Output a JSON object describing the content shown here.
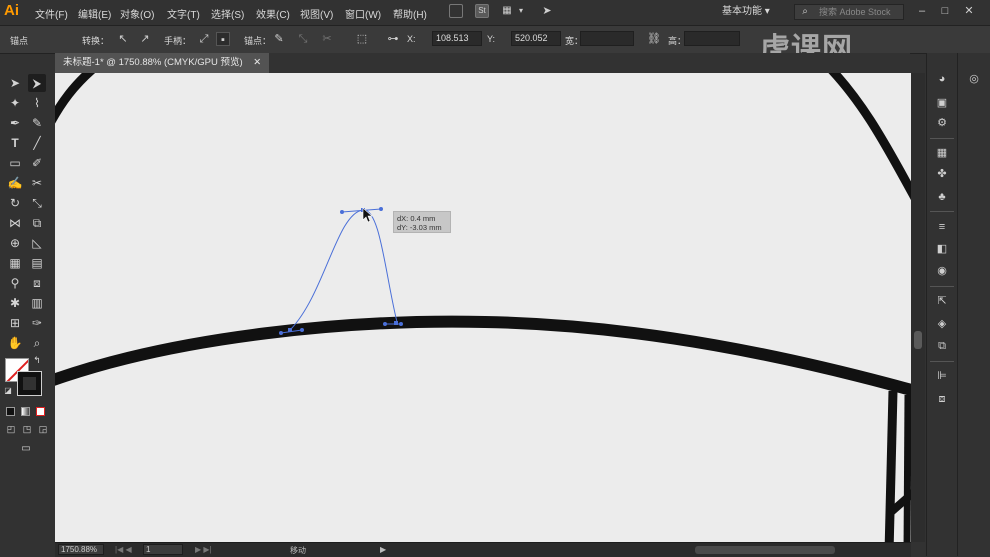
{
  "app": {
    "logo": "Ai"
  },
  "menu": [
    "文件(F)",
    "编辑(E)",
    "对象(O)",
    "文字(T)",
    "选择(S)",
    "效果(C)",
    "视图(V)",
    "窗口(W)",
    "帮助(H)"
  ],
  "menubar_icons": {
    "br": "Br",
    "st": "St"
  },
  "workspace": {
    "label": "基本功能",
    "chevron": "▾"
  },
  "search": {
    "placeholder": "搜索 Adobe Stock"
  },
  "window_controls": {
    "minimize": "–",
    "maximize": "□",
    "close": "✕"
  },
  "control_bar": {
    "mode_label": "锚点",
    "convert_label": "转换：",
    "handle_label": "手柄：",
    "anchor_label": "锚点：",
    "x_label": "X:",
    "x_value": "108.513",
    "y_label": "Y:",
    "y_value": "520.052",
    "w_label": "宽：",
    "h_label": "高："
  },
  "watermark": "虎课网",
  "document_tab": {
    "title": "未标题-1* @ 1750.88% (CMYK/GPU 预览)",
    "close": "✕"
  },
  "tooltip": {
    "dx": "dX: 0.4 mm",
    "dy": "dY: -3.03 mm"
  },
  "status_bar": {
    "zoom": "1750.88%",
    "artboard": "1",
    "status": "移动"
  },
  "colors": {
    "fill": "#ffffff",
    "stroke": "#111111",
    "path_selection": "#4a6fd8",
    "canvas": "#ececec"
  }
}
